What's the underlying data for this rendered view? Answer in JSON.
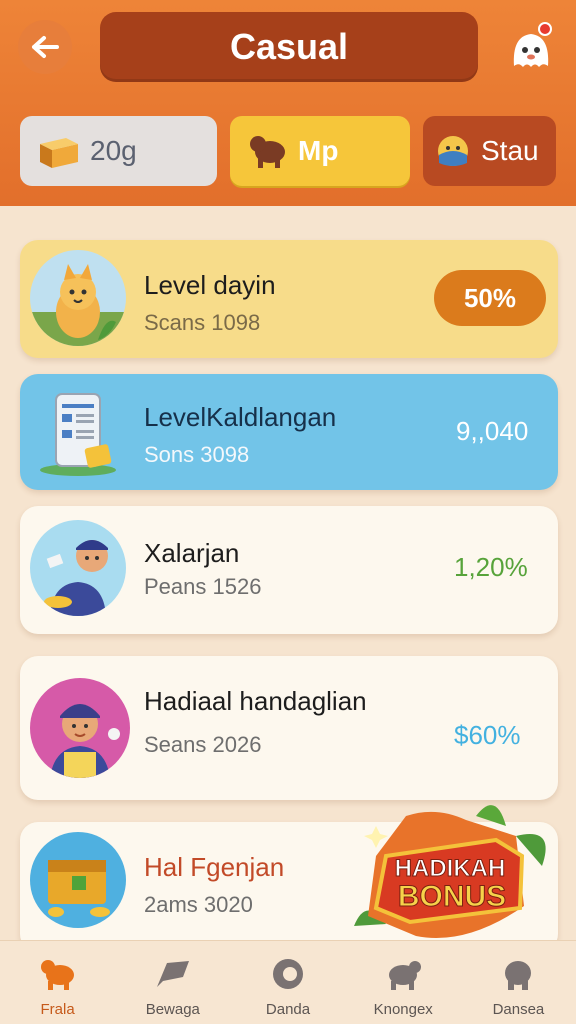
{
  "header": {
    "title": "Casual",
    "back_icon": "arrow-left-icon",
    "profile_icon": "ghost-avatar-icon"
  },
  "tabs": [
    {
      "label": "20g",
      "icon": "gold-bar-icon"
    },
    {
      "label": "Mp",
      "icon": "bear-icon",
      "active": true
    },
    {
      "label": "Stau",
      "icon": "face-icon"
    }
  ],
  "cards": [
    {
      "name": "Level dayin",
      "sub": "Scans 1098",
      "value": "50%",
      "icon": "fox-avatar"
    },
    {
      "name": "LevelKaldlangan",
      "sub": "Sons 3098",
      "value": "9,,040",
      "icon": "phone-document"
    },
    {
      "name": "Xalarjan",
      "sub": "Peans 1526",
      "value": "1,20%",
      "icon": "courier-avatar"
    },
    {
      "name": "Hadiaal handaglian",
      "sub": "Seans 2026",
      "value": "$60%",
      "icon": "chef-avatar"
    },
    {
      "name": "Hal Fgenjan",
      "sub": "2ams 3020",
      "value": "",
      "icon": "treasure-chest"
    }
  ],
  "bonus": {
    "line1": "HADIKAH",
    "line2": "BONUS"
  },
  "nav": [
    {
      "label": "Frala",
      "icon": "animal-icon",
      "active": true
    },
    {
      "label": "Bewaga",
      "icon": "flag-icon"
    },
    {
      "label": "Danda",
      "icon": "coin-icon"
    },
    {
      "label": "Knongex",
      "icon": "dog-icon"
    },
    {
      "label": "Dansea",
      "icon": "elephant-icon"
    }
  ],
  "colors": {
    "header": "#e77a32",
    "title_pill": "#a6401a",
    "accent_yellow": "#f6c63a",
    "card_blue": "#72c4e8",
    "pct_orange": "#db7b1c",
    "green": "#57a33a",
    "light_blue": "#43b1e0"
  }
}
